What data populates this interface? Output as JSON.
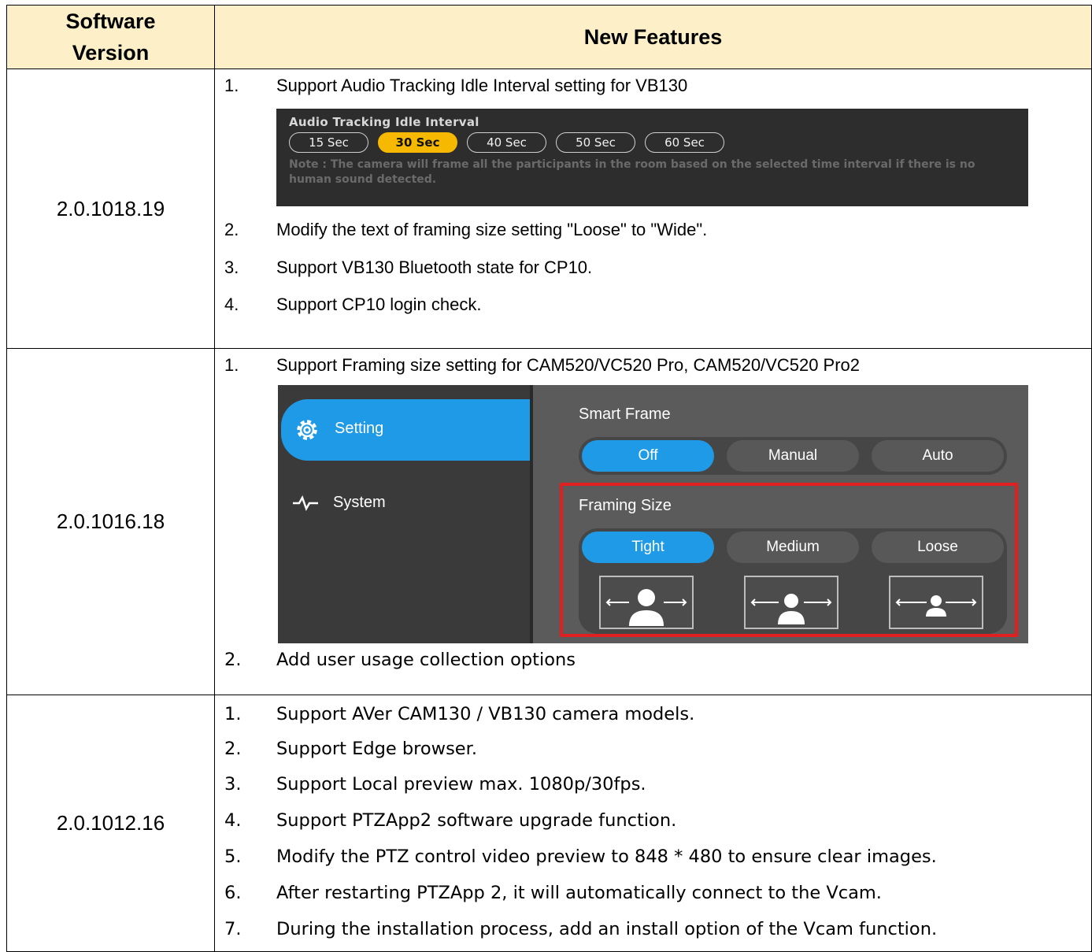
{
  "headers": {
    "version": "Software Version",
    "features": "New Features"
  },
  "rows": [
    {
      "version": "2.0.1018.19",
      "items": [
        {
          "num": "1.",
          "text": "Support Audio Tracking Idle Interval setting for VB130"
        },
        {
          "num": "2.",
          "text": "Modify the text of framing size setting \"Loose\" to \"Wide\"."
        },
        {
          "num": "3.",
          "text": "Support VB130 Bluetooth state for CP10."
        },
        {
          "num": "4.",
          "text": "Support CP10 login check."
        }
      ],
      "audio_panel": {
        "title": "Audio Tracking Idle Interval",
        "options": [
          "15 Sec",
          "30 Sec",
          "40 Sec",
          "50 Sec",
          "60 Sec"
        ],
        "selected": "30 Sec",
        "note_line1": "Note : The camera will frame all the participants in the room based on the selected time interval if there is no",
        "note_line2": "human sound detected."
      }
    },
    {
      "version": "2.0.1016.18",
      "items": [
        {
          "num": "1.",
          "text": "Support Framing size setting for CAM520/VC520 Pro, CAM520/VC520 Pro2"
        },
        {
          "num": "2.",
          "text": "Add user usage collection options"
        }
      ],
      "framing_panel": {
        "tab_setting": "Setting",
        "tab_system": "System",
        "smart_frame_label": "Smart Frame",
        "smart_frame_options": [
          "Off",
          "Manual",
          "Auto"
        ],
        "smart_frame_selected": "Off",
        "framing_size_label": "Framing Size",
        "framing_size_options": [
          "Tight",
          "Medium",
          "Loose"
        ],
        "framing_size_selected": "Tight",
        "accent_color": "#1f9ae6",
        "highlight_color": "#e02020"
      }
    },
    {
      "version": "2.0.1012.16",
      "items": [
        {
          "num": "1.",
          "text": "Support AVer CAM130 / VB130 camera models."
        },
        {
          "num": "2.",
          "text": "Support Edge browser."
        },
        {
          "num": "3.",
          "text": "Support Local preview max. 1080p/30fps."
        },
        {
          "num": "4.",
          "text": "Support PTZApp2 software upgrade function."
        },
        {
          "num": "5.",
          "text": "Modify the PTZ control video preview to 848 * 480 to ensure clear images."
        },
        {
          "num": "6.",
          "text": "After restarting PTZApp 2, it will automatically connect to the Vcam."
        },
        {
          "num": "7.",
          "text": "During the installation process, add an install option of the Vcam function."
        }
      ]
    }
  ],
  "header_bg": "#fdf0c8",
  "audio_selected_color": "#f6b800"
}
